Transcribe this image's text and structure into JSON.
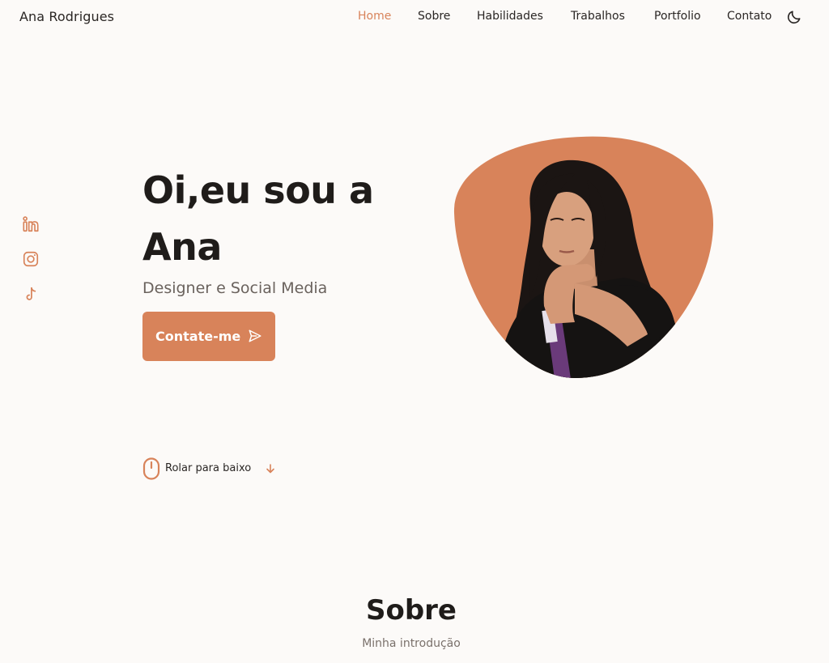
{
  "header": {
    "logo": "Ana Rodrigues",
    "nav": [
      {
        "label": "Home",
        "active": true
      },
      {
        "label": "Sobre"
      },
      {
        "label": "Habilidades"
      },
      {
        "label": "Trabalhos"
      },
      {
        "label": "Portfolio"
      },
      {
        "label": "Contato"
      }
    ],
    "theme_icon": "moon-icon"
  },
  "social": [
    "linkedin-icon",
    "instagram-icon",
    "tiktok-icon"
  ],
  "hero": {
    "title_line1": "Oi,eu sou a",
    "title_line2": "Ana",
    "subtitle": "Designer e Social Media",
    "cta_label": "Contate-me",
    "cta_icon": "send-icon",
    "image_desc": "portrait photo in orange blob"
  },
  "scroll": {
    "label": "Rolar para baixo",
    "icon": "mouse-icon",
    "arrow": "arrow-down-icon"
  },
  "about": {
    "title": "Sobre",
    "subtitle": "Minha introdução"
  },
  "colors": {
    "accent": "#d8835a",
    "background": "#fcfaf8",
    "text": "#1f1c1a"
  }
}
